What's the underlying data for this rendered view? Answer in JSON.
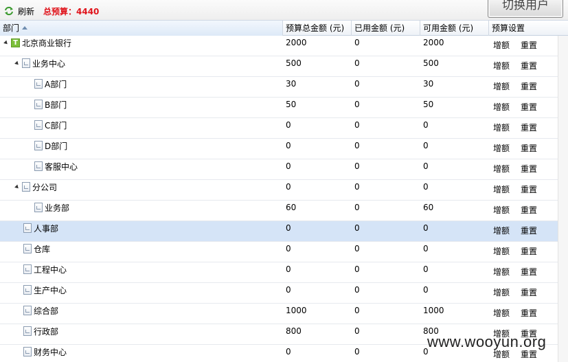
{
  "toolbar": {
    "refresh_label": "刷新",
    "total_budget": "总预算：4440",
    "switch_user_label": "切换用户"
  },
  "columns": [
    "部门",
    "预算总金额 (元)",
    "已用金额 (元)",
    "可用金额 (元)",
    "预算设置"
  ],
  "actions": {
    "increase": "增额",
    "reset": "重置"
  },
  "rows": [
    {
      "name": "北京商业银行",
      "budget": "2000",
      "used": "0",
      "available": "2000"
    },
    {
      "name": "业务中心",
      "budget": "500",
      "used": "0",
      "available": "500"
    },
    {
      "name": "A部门",
      "budget": "30",
      "used": "0",
      "available": "30"
    },
    {
      "name": "B部门",
      "budget": "50",
      "used": "0",
      "available": "50"
    },
    {
      "name": "C部门",
      "budget": "0",
      "used": "0",
      "available": "0"
    },
    {
      "name": "D部门",
      "budget": "0",
      "used": "0",
      "available": "0"
    },
    {
      "name": "客服中心",
      "budget": "0",
      "used": "0",
      "available": "0"
    },
    {
      "name": "分公司",
      "budget": "0",
      "used": "0",
      "available": "0"
    },
    {
      "name": "业务部",
      "budget": "60",
      "used": "0",
      "available": "60"
    },
    {
      "name": "人事部",
      "budget": "0",
      "used": "0",
      "available": "0"
    },
    {
      "name": "仓库",
      "budget": "0",
      "used": "0",
      "available": "0"
    },
    {
      "name": "工程中心",
      "budget": "0",
      "used": "0",
      "available": "0"
    },
    {
      "name": "生产中心",
      "budget": "0",
      "used": "0",
      "available": "0"
    },
    {
      "name": "综合部",
      "budget": "1000",
      "used": "0",
      "available": "1000"
    },
    {
      "name": "行政部",
      "budget": "800",
      "used": "0",
      "available": "800"
    },
    {
      "name": "财务中心",
      "budget": "0",
      "used": "0",
      "available": "0"
    }
  ],
  "watermark": "www.wooyun.org",
  "colors": {
    "accent_red": "#e0151c",
    "selected_row": "#d5e4f7",
    "root_icon": "#7cbf3a"
  }
}
